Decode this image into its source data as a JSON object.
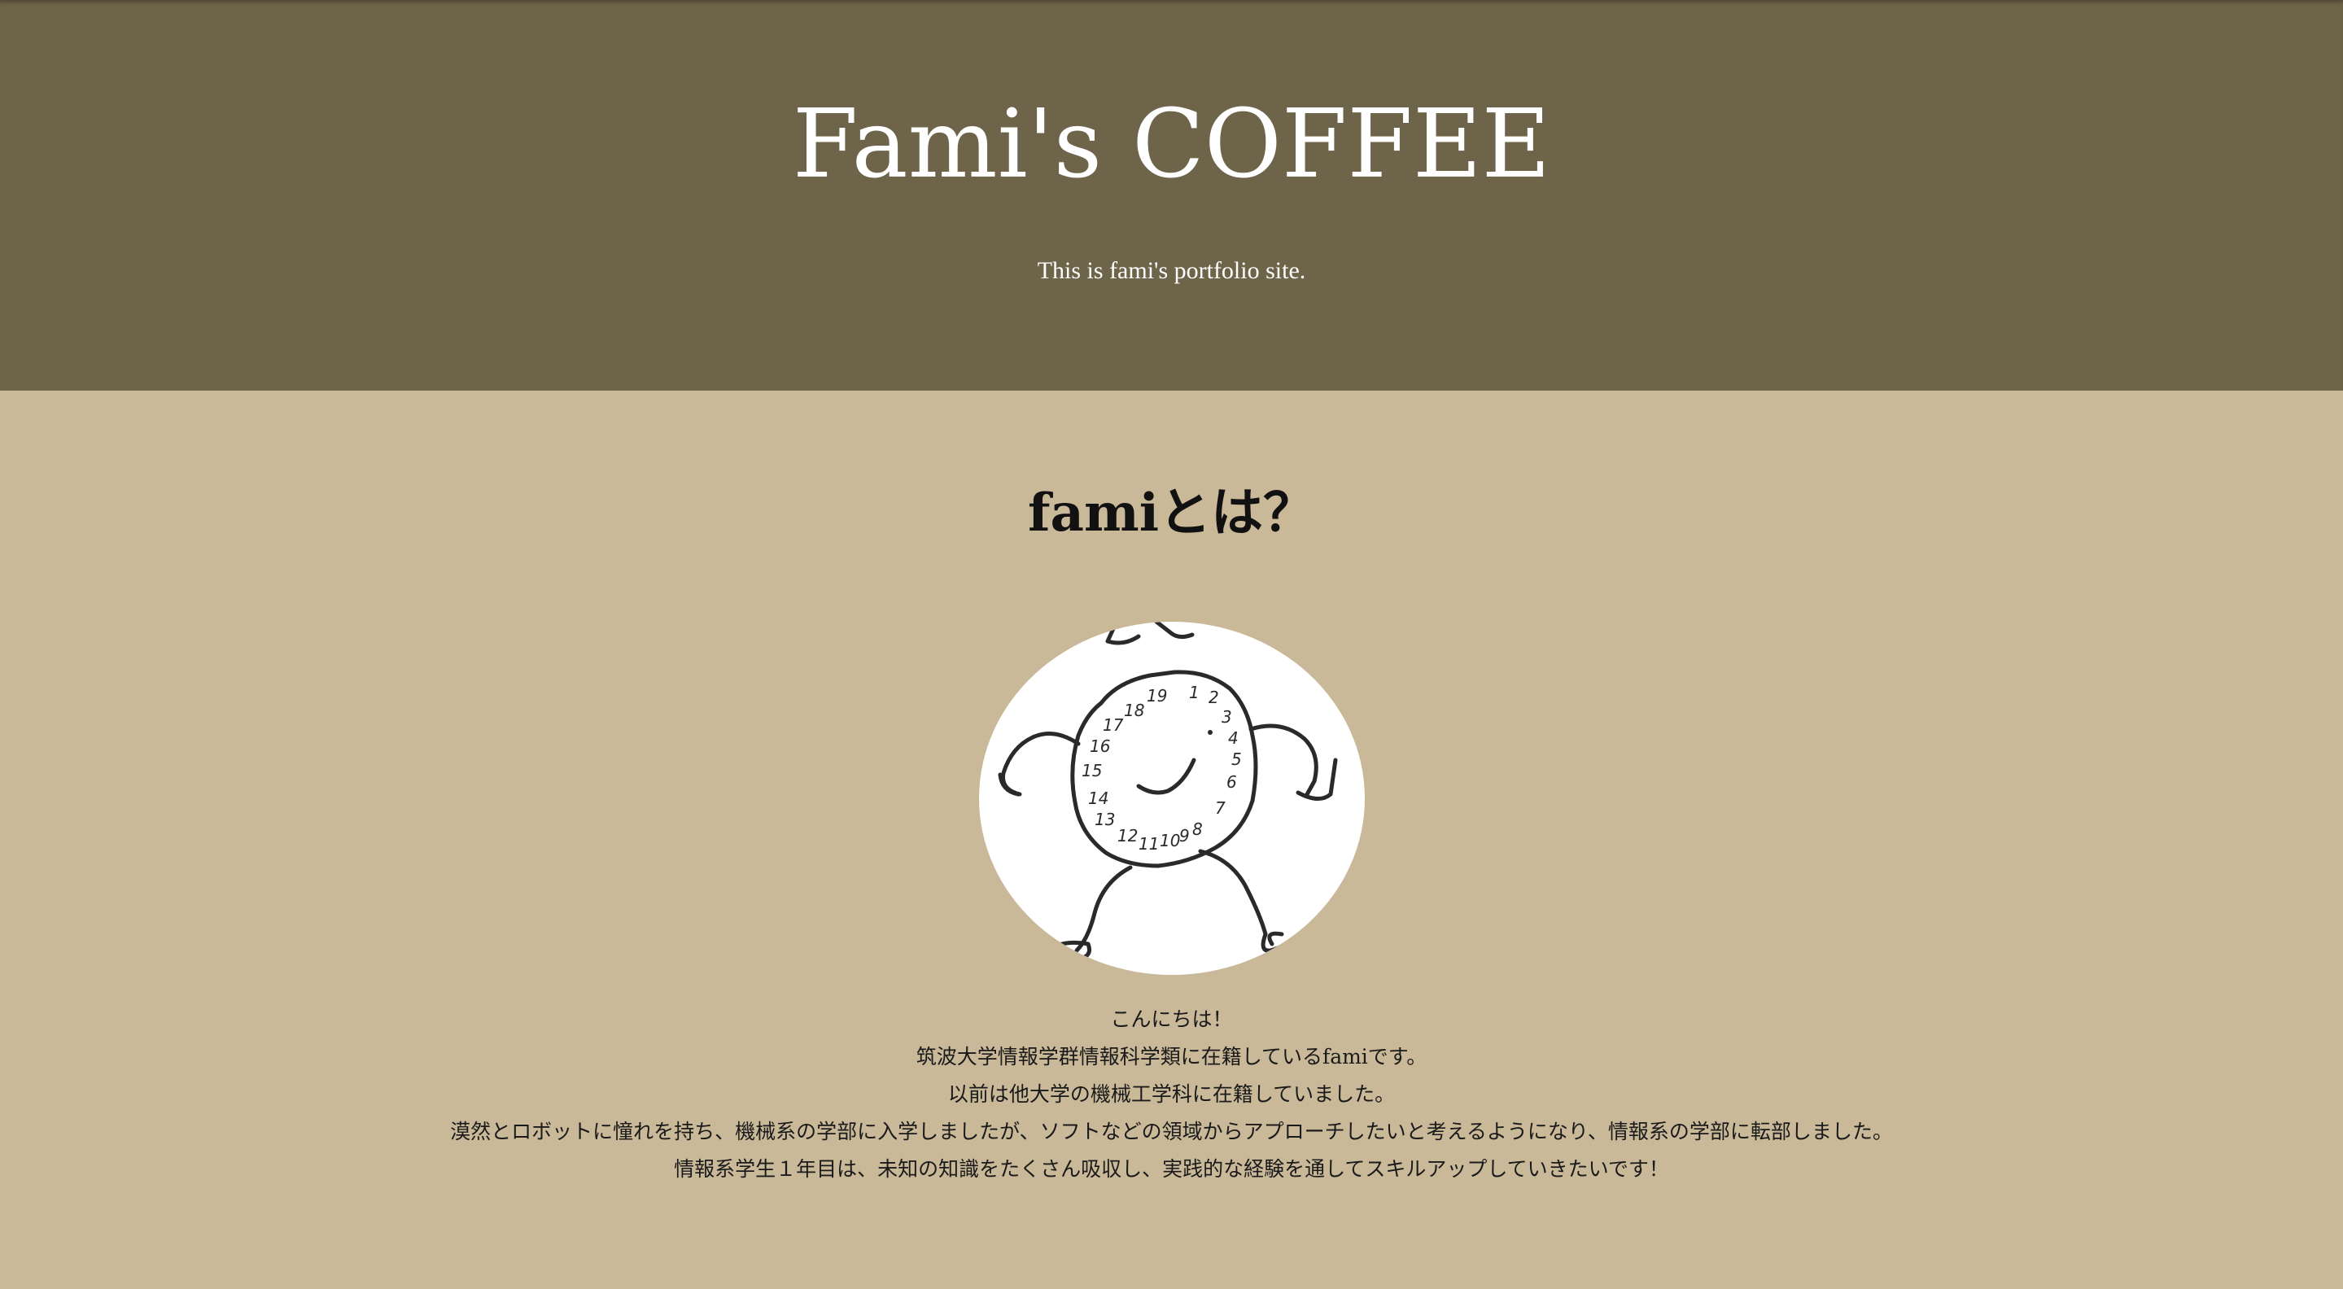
{
  "header": {
    "title": "Fami's COFFEE",
    "subtitle": "This is fami's portfolio site."
  },
  "about": {
    "heading": "famiとは？",
    "avatar_icon": "clock-character-drawing",
    "paragraphs": [
      "こんにちは！",
      "筑波大学情報学群情報科学類に在籍しているfamiです。",
      "以前は他大学の機械工学科に在籍していました。",
      "漠然とロボットに憧れを持ち、機械系の学部に入学しましたが、ソフトなどの領域からアプローチしたいと考えるようになり、情報系の学部に転部しました。",
      "情報系学生１年目は、未知の知識をたくさん吸収し、実践的な経験を通してスキルアップしていきたいです！"
    ]
  },
  "colors": {
    "header_bg": "#6e6449",
    "main_bg": "#c9b999",
    "header_text": "#ffffff",
    "body_text": "#1a1a1a"
  }
}
